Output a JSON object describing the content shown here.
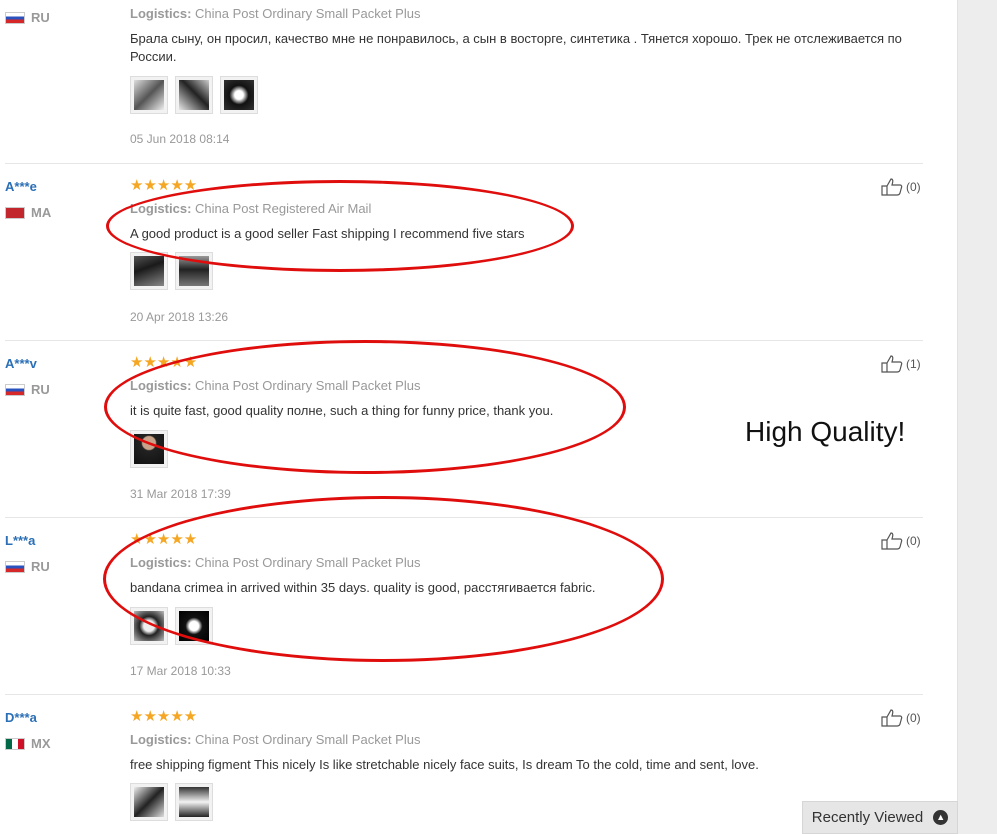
{
  "colors": {
    "username": "#2b6fb6",
    "stars": "#f5a623",
    "annotation_oval": "#e00d0d",
    "muted_text": "#999999"
  },
  "reviews": [
    {
      "user": "",
      "country": "RU",
      "flag": "russia-flag",
      "rating": 5,
      "stars_text": "",
      "logistics_label": "Logistics:",
      "logistics_value": "China Post Ordinary Small Packet Plus",
      "text": "Брала сыну, он просил, качество мне не понравилось, а сын в восторге, синтетика . Тянется хорошо. Трек не отслеживается по России.",
      "photos": 3,
      "date": "05 Jun 2018 08:14",
      "helpful": ""
    },
    {
      "user": "A***e",
      "country": "MA",
      "flag": "morocco-flag",
      "rating": 5,
      "stars_text": "★★★★★",
      "logistics_label": "Logistics:",
      "logistics_value": "China Post Registered Air Mail",
      "text": "A good product is a good seller Fast shipping I recommend five stars",
      "photos": 2,
      "date": "20 Apr 2018 13:26",
      "helpful": "(0)"
    },
    {
      "user": "A***v",
      "country": "RU",
      "flag": "russia-flag",
      "rating": 5,
      "stars_text": "★★★★★",
      "logistics_label": "Logistics:",
      "logistics_value": "China Post Ordinary Small Packet Plus",
      "text": "it is quite fast, good quality полне, such a thing for funny price, thank you.",
      "photos": 1,
      "date": "31 Mar 2018 17:39",
      "helpful": "(1)"
    },
    {
      "user": "L***a",
      "country": "RU",
      "flag": "russia-flag",
      "rating": 5,
      "stars_text": "★★★★★",
      "logistics_label": "Logistics:",
      "logistics_value": "China Post Ordinary Small Packet Plus",
      "text": "bandana crimea in arrived within 35 days. quality is good, расстягивается fabric.",
      "photos": 2,
      "date": "17 Mar 2018 10:33",
      "helpful": "(0)"
    },
    {
      "user": "D***a",
      "country": "MX",
      "flag": "mexico-flag",
      "rating": 5,
      "stars_text": "★★★★★",
      "logistics_label": "Logistics:",
      "logistics_value": "China Post Ordinary Small Packet Plus",
      "text": "free shipping figment This nicely Is like stretchable nicely face suits, Is dream To the cold, time and sent, love.",
      "photos": 2,
      "date": "",
      "helpful": "(0)"
    }
  ],
  "overlay_caption": "High Quality!",
  "recently_viewed": {
    "label": "Recently Viewed",
    "icon": "chevron-up-circle-icon"
  }
}
